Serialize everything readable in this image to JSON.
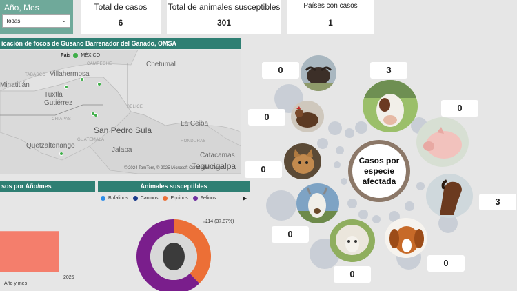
{
  "filter": {
    "label": "Año, Mes",
    "value": "Todas"
  },
  "kpis": [
    {
      "title": "Total de casos",
      "value": "6"
    },
    {
      "title": "Total de animales susceptibles",
      "value": "301"
    },
    {
      "title": "Países con casos",
      "value": "1"
    }
  ],
  "map": {
    "title": "icación de focos de Gusano Barrenador del Ganado, OMSA",
    "legend_label": "País",
    "legend_item": "MÉXICO",
    "legend_color": "#3fae49",
    "places": [
      "Villahermosa",
      "Tuxtla Gutiérrez",
      "Minatitlán",
      "San Pedro Sula",
      "Quetzaltenango",
      "La Ceiba",
      "Jalapa",
      "Catacamas",
      "Tegucigalpa",
      "HONDURAS",
      "GUATEMALA",
      "BELICE",
      "Chetumal",
      "TABASCO",
      "CAMPECHE",
      "CHIAPAS"
    ],
    "attribution": "© 2024 TomTom, © 2025 Microsoft Corporation  Terms"
  },
  "cases_chart": {
    "title": "sos por Año/mes",
    "xlabel": "Año y mes",
    "chart_data": {
      "type": "bar",
      "categories": [
        "2025"
      ],
      "values": [
        6
      ],
      "xlabel": "Año y mes",
      "bar_color": "#f47e6c"
    }
  },
  "susceptible": {
    "title": "Animales susceptibles",
    "legend": [
      {
        "label": "Bufalinos",
        "color": "#2e8de8"
      },
      {
        "label": "Caninos",
        "color": "#1a3b8c"
      },
      {
        "label": "Equinos",
        "color": "#ec6f36"
      },
      {
        "label": "Felinos",
        "color": "#7030a0"
      }
    ],
    "annotation": "114 (37.87%)",
    "chart_data": {
      "type": "pie",
      "labels": [
        "Equinos",
        "Felinos"
      ],
      "values": [
        114,
        187
      ],
      "colors": [
        "#ec6f36",
        "#7a1e8c"
      ]
    }
  },
  "species": {
    "center_label": [
      "Casos por",
      "especie",
      "afectada"
    ],
    "counts": {
      "bufalinos": "0",
      "bovinos": "3",
      "porcinos": "0",
      "aves": "0",
      "felinos": "0",
      "equinos": "3",
      "caprinos": "0",
      "ovinos": "0",
      "caninos": "0"
    }
  }
}
